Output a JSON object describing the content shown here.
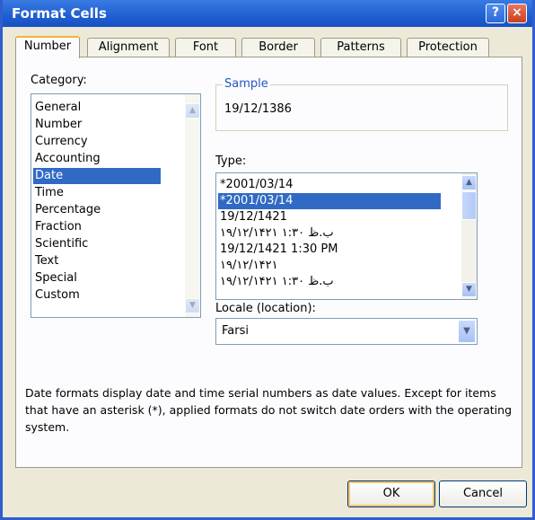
{
  "window": {
    "title": "Format Cells",
    "help_symbol": "?",
    "close_symbol": "×"
  },
  "tabs": [
    "Number",
    "Alignment",
    "Font",
    "Border",
    "Patterns",
    "Protection"
  ],
  "category": {
    "label": "Category:",
    "items": [
      "General",
      "Number",
      "Currency",
      "Accounting",
      "Date",
      "Time",
      "Percentage",
      "Fraction",
      "Scientific",
      "Text",
      "Special",
      "Custom"
    ],
    "selected": "Date"
  },
  "sample": {
    "label": "Sample",
    "value": "19/12/1386"
  },
  "type": {
    "label": "Type:",
    "items": [
      "*2001/03/14",
      "*2001/03/14",
      "19/12/1421",
      "۱۹/۱۲/۱۴۲۱ ۱:۳۰ ب.ظ",
      "19/12/1421 1:30 PM",
      "۱۹/۱۲/۱۴۲۱",
      "۱۹/۱۲/۱۴۲۱ ۱:۳۰ ب.ظ"
    ],
    "selected_index": 1
  },
  "locale": {
    "label": "Locale (location):",
    "value": "Farsi"
  },
  "description": "Date formats display date and time serial numbers as date values. Except for items that have an asterisk (*), applied formats do not switch date orders with the operating system.",
  "buttons": {
    "ok": "OK",
    "cancel": "Cancel"
  },
  "colors": {
    "title_bar": "#1f5ed1",
    "selection": "#316ac5",
    "sample_label": "#2356c7"
  }
}
